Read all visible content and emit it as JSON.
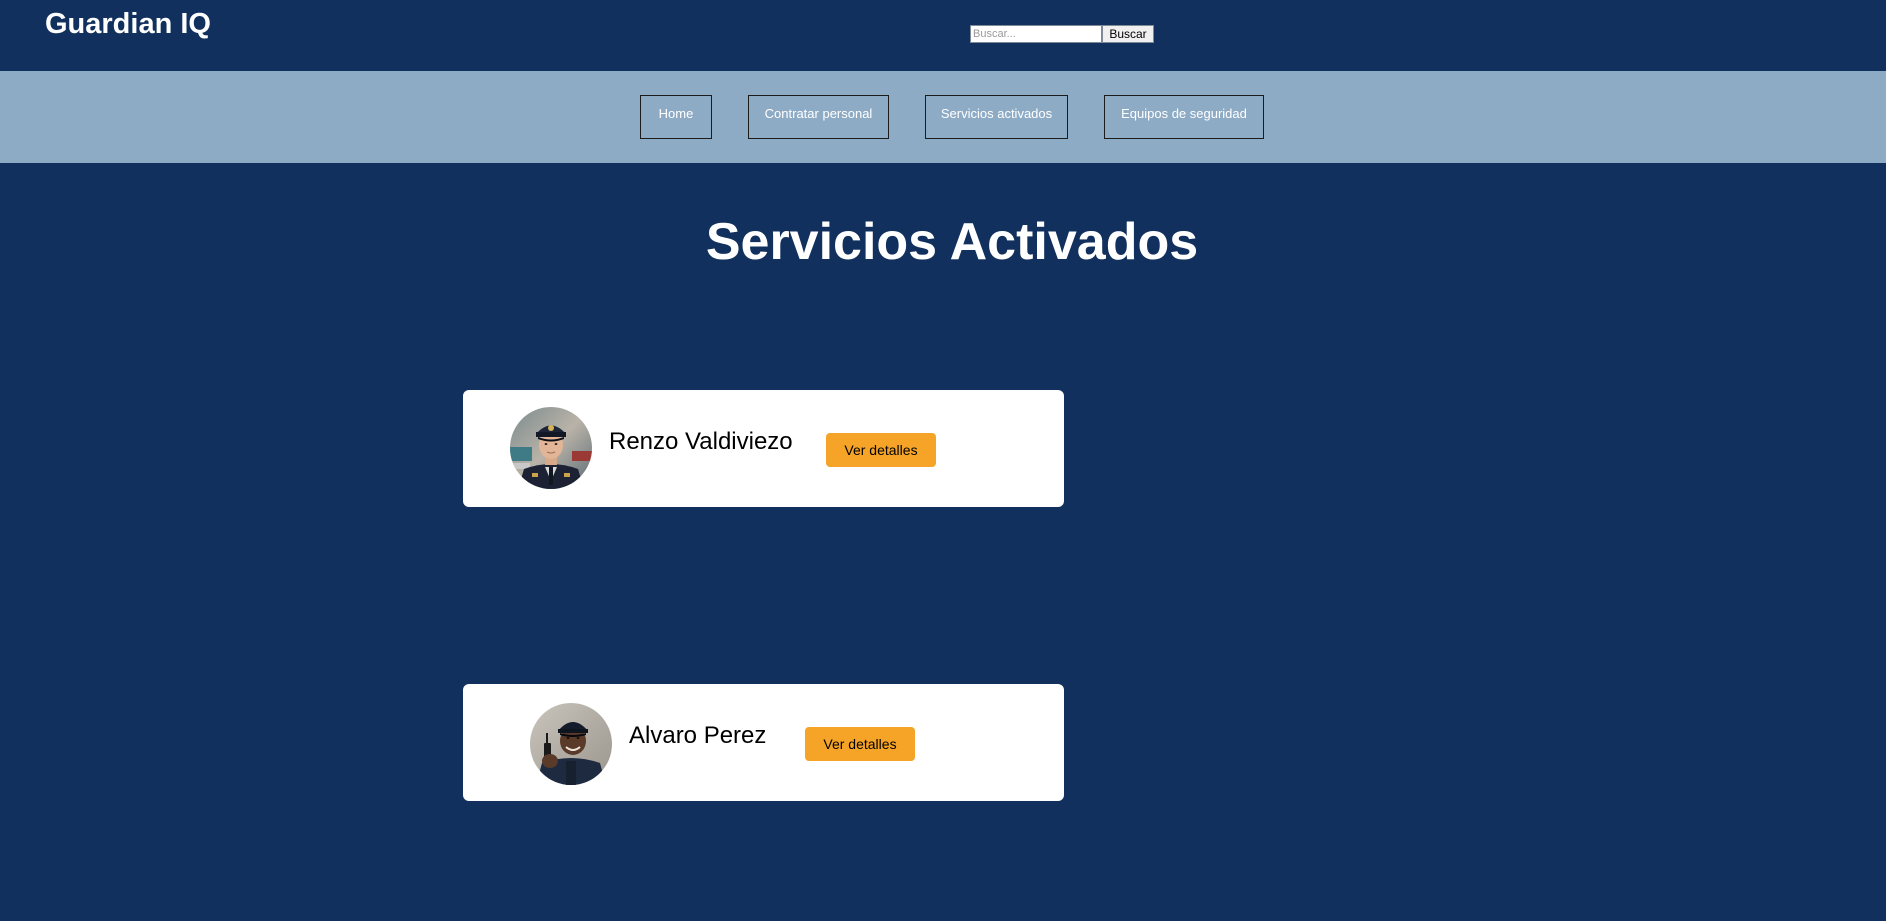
{
  "header": {
    "brand": "Guardian IQ",
    "search": {
      "placeholder": "Buscar...",
      "value": "",
      "button_label": "Buscar"
    }
  },
  "nav": {
    "items": [
      {
        "label": "Home"
      },
      {
        "label": "Contratar personal"
      },
      {
        "label": "Servicios activados"
      },
      {
        "label": "Equipos de seguridad"
      }
    ]
  },
  "main": {
    "title": "Servicios Activados",
    "services": [
      {
        "name": "Renzo Valdiviezo",
        "button_label": "Ver detalles",
        "avatar": "police-officer-avatar"
      },
      {
        "name": "Alvaro Perez",
        "button_label": "Ver detalles",
        "avatar": "security-guard-avatar"
      }
    ]
  },
  "colors": {
    "background": "#11305d",
    "nav_band": "#8eabc6",
    "accent_button": "#f6a427",
    "card": "#ffffff"
  }
}
